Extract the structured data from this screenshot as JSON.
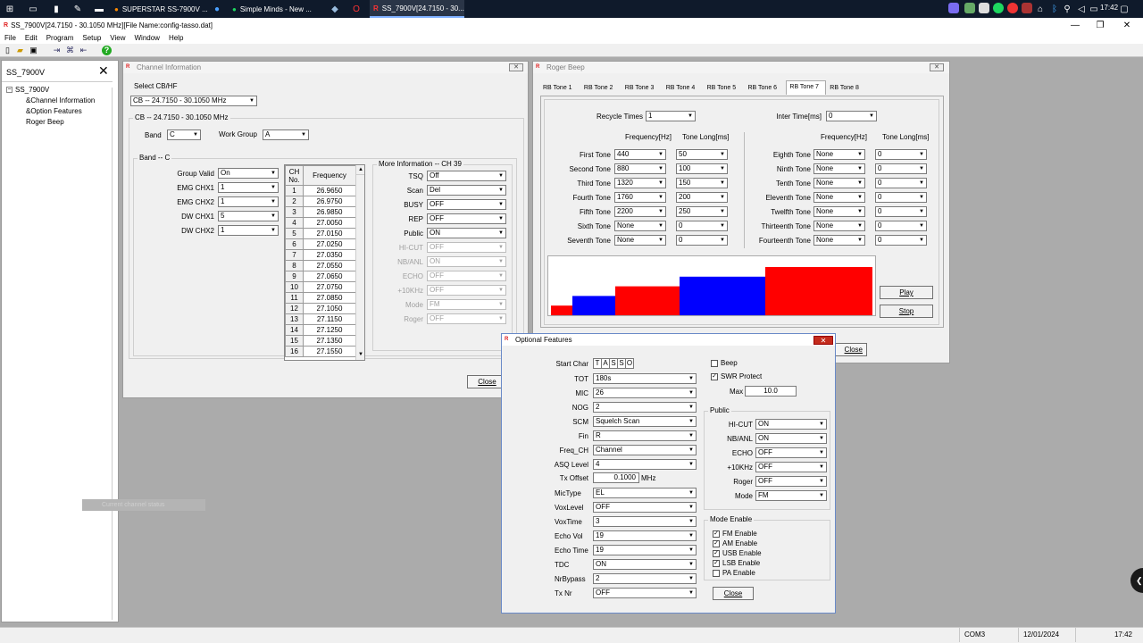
{
  "taskbar": {
    "apps": [
      {
        "label": "SUPERSTAR SS-7900V ..."
      },
      {
        "label": "Simple Minds - New ..."
      },
      {
        "label": "SS_7900V[24.7150 - 30..."
      }
    ],
    "time": "17:42"
  },
  "window": {
    "title": "SS_7900V[24.7150 - 30.1050 MHz][File Name:config-tasso.dat]"
  },
  "menu": [
    "File",
    "Edit",
    "Program",
    "Setup",
    "View",
    "Window",
    "Help"
  ],
  "tree": {
    "header": "SS_7900V",
    "root": "SS_7900V",
    "items": [
      "&Channel Information",
      "&Option Features",
      "Roger Beep"
    ]
  },
  "ghost_text": "Current channel status",
  "channel_info": {
    "title": "Channel Information",
    "select_label": "Select CB/HF",
    "select_value": "CB -- 24.7150 - 30.1050 MHz",
    "group_title": "CB -- 24.7150 - 30.1050 MHz",
    "band_label": "Band",
    "band_value": "C",
    "workgroup_label": "Work Group",
    "workgroup_value": "A",
    "bandc_title": "Band -- C",
    "fields": [
      {
        "label": "Group Valid",
        "value": "On"
      },
      {
        "label": "EMG CHX1",
        "value": "1"
      },
      {
        "label": "EMG CHX2",
        "value": "1"
      },
      {
        "label": "DW CHX1",
        "value": "5"
      },
      {
        "label": "DW CHX2",
        "value": "1"
      }
    ],
    "table_headers": [
      "CH No.",
      "Frequency"
    ],
    "channels": [
      [
        "1",
        "26.9650"
      ],
      [
        "2",
        "26.9750"
      ],
      [
        "3",
        "26.9850"
      ],
      [
        "4",
        "27.0050"
      ],
      [
        "5",
        "27.0150"
      ],
      [
        "6",
        "27.0250"
      ],
      [
        "7",
        "27.0350"
      ],
      [
        "8",
        "27.0550"
      ],
      [
        "9",
        "27.0650"
      ],
      [
        "10",
        "27.0750"
      ],
      [
        "11",
        "27.0850"
      ],
      [
        "12",
        "27.1050"
      ],
      [
        "13",
        "27.1150"
      ],
      [
        "14",
        "27.1250"
      ],
      [
        "15",
        "27.1350"
      ],
      [
        "16",
        "27.1550"
      ]
    ],
    "more_title": "More Information -- CH 39",
    "more": [
      {
        "label": "TSQ",
        "value": "Off",
        "dis": false
      },
      {
        "label": "Scan",
        "value": "Del",
        "dis": false
      },
      {
        "label": "BUSY",
        "value": "OFF",
        "dis": false
      },
      {
        "label": "REP",
        "value": "OFF",
        "dis": false
      },
      {
        "label": "Public",
        "value": "ON",
        "dis": false
      },
      {
        "label": "HI-CUT",
        "value": "OFF",
        "dis": true
      },
      {
        "label": "NB/ANL",
        "value": "ON",
        "dis": true
      },
      {
        "label": "ECHO",
        "value": "OFF",
        "dis": true
      },
      {
        "label": "+10KHz",
        "value": "OFF",
        "dis": true
      },
      {
        "label": "Mode",
        "value": "FM",
        "dis": true
      },
      {
        "label": "Roger",
        "value": "OFF",
        "dis": true
      }
    ],
    "close": "Close"
  },
  "roger": {
    "title": "Roger Beep",
    "tabs": [
      "RB Tone 1",
      "RB Tone 2",
      "RB Tone 3",
      "RB Tone 4",
      "RB Tone 5",
      "RB Tone 6",
      "RB Tone 7",
      "RB Tone 8"
    ],
    "active_tab": 6,
    "recycle_label": "Recycle Times",
    "recycle_value": "1",
    "inter_label": "Inter Time[ms]",
    "inter_value": "0",
    "freq_header": "Frequency[Hz]",
    "long_header": "Tone Long[ms]",
    "left": [
      {
        "label": "First Tone",
        "freq": "440",
        "long": "50"
      },
      {
        "label": "Second Tone",
        "freq": "880",
        "long": "100"
      },
      {
        "label": "Third Tone",
        "freq": "1320",
        "long": "150"
      },
      {
        "label": "Fourth Tone",
        "freq": "1760",
        "long": "200"
      },
      {
        "label": "Fifth Tone",
        "freq": "2200",
        "long": "250"
      },
      {
        "label": "Sixth Tone",
        "freq": "None",
        "long": "0"
      },
      {
        "label": "Seventh Tone",
        "freq": "None",
        "long": "0"
      }
    ],
    "right": [
      {
        "label": "Eighth Tone",
        "freq": "None",
        "long": "0"
      },
      {
        "label": "Ninth Tone",
        "freq": "None",
        "long": "0"
      },
      {
        "label": "Tenth Tone",
        "freq": "None",
        "long": "0"
      },
      {
        "label": "Eleventh Tone",
        "freq": "None",
        "long": "0"
      },
      {
        "label": "Twelfth Tone",
        "freq": "None",
        "long": "0"
      },
      {
        "label": "Thirteenth Tone",
        "freq": "None",
        "long": "0"
      },
      {
        "label": "Fourteenth Tone",
        "freq": "None",
        "long": "0"
      }
    ],
    "play": "Play",
    "stop": "Stop",
    "close": "Close",
    "bar_colors": [
      "#ff0000",
      "#0000ff"
    ]
  },
  "optional": {
    "title": "Optional Features",
    "start_char_label": "Start Char",
    "start_chars": [
      "T",
      "A",
      "S",
      "S",
      "O"
    ],
    "fields": [
      {
        "label": "TOT",
        "value": "180s"
      },
      {
        "label": "MIC",
        "value": "26"
      },
      {
        "label": "NOG",
        "value": "2"
      },
      {
        "label": "SCM",
        "value": "Squelch Scan"
      },
      {
        "label": "Fin",
        "value": "R"
      },
      {
        "label": "Freq_CH",
        "value": "Channel"
      },
      {
        "label": "ASQ Level",
        "value": "4"
      }
    ],
    "txoffset_label": "Tx Offset",
    "txoffset_value": "0.1000",
    "txoffset_unit": "MHz",
    "fields2": [
      {
        "label": "MicType",
        "value": "EL"
      },
      {
        "label": "VoxLevel",
        "value": "OFF"
      },
      {
        "label": "VoxTime",
        "value": "3"
      },
      {
        "label": "Echo Vol",
        "value": "19"
      },
      {
        "label": "Echo Time",
        "value": "19"
      },
      {
        "label": "TDC",
        "value": "ON"
      },
      {
        "label": "NrBypass",
        "value": "2"
      },
      {
        "label": "Tx Nr",
        "value": "OFF"
      }
    ],
    "beep_label": "Beep",
    "beep_checked": false,
    "swr_label": "SWR Protect",
    "swr_checked": true,
    "max_label": "Max",
    "max_value": "10.0",
    "public_title": "Public",
    "public": [
      {
        "label": "HI-CUT",
        "value": "ON"
      },
      {
        "label": "NB/ANL",
        "value": "ON"
      },
      {
        "label": "ECHO",
        "value": "OFF"
      },
      {
        "label": "+10KHz",
        "value": "OFF"
      },
      {
        "label": "Roger",
        "value": "OFF"
      },
      {
        "label": "Mode",
        "value": "FM"
      }
    ],
    "mode_title": "Mode Enable",
    "modes": [
      {
        "label": "FM Enable",
        "checked": true
      },
      {
        "label": "AM Enable",
        "checked": true
      },
      {
        "label": "USB Enable",
        "checked": true
      },
      {
        "label": "LSB Enable",
        "checked": true
      },
      {
        "label": "PA Enable",
        "checked": false
      }
    ],
    "close": "Close"
  },
  "status": {
    "port": "COM3",
    "date": "12/01/2024",
    "time": "17:42"
  }
}
